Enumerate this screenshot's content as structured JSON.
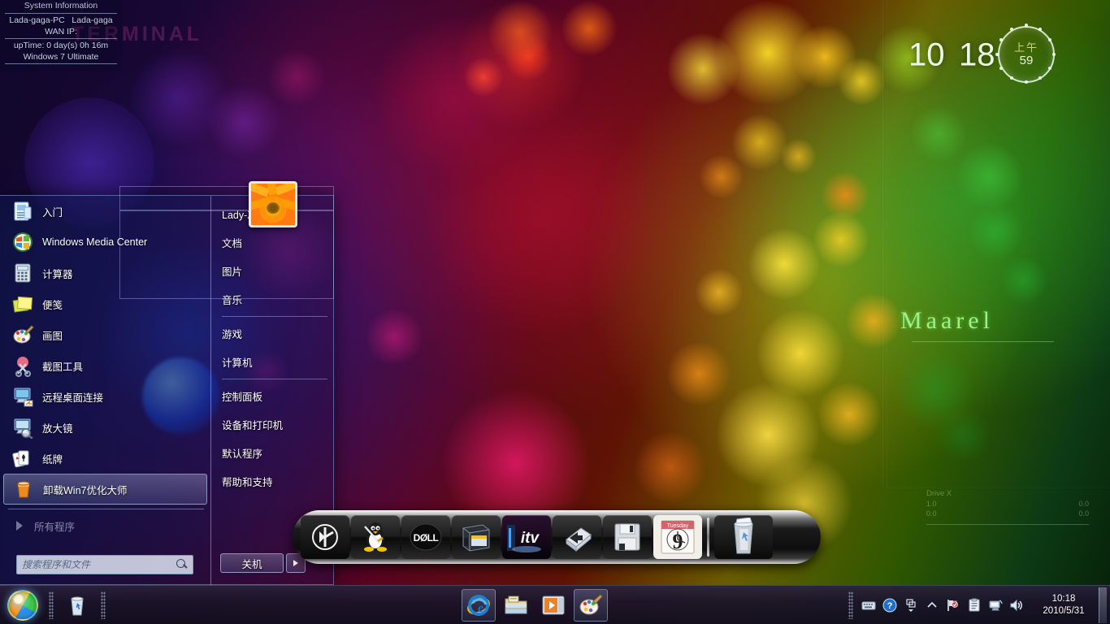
{
  "desktop": {
    "wallpaper_name": "bokeh-lights-wallpaper",
    "watermark_text": "Maarel",
    "faint_text": "TERMINAL",
    "accent_green": "#9ef08c",
    "colors": {
      "purple": "#5a0420",
      "red": "#c81428",
      "yellow": "#e6d21e",
      "green": "#1eb43c",
      "blue": "#2828be"
    }
  },
  "gadgets": {
    "system_info": {
      "title": "System Information",
      "computer_name": "Lada-gaga-PC",
      "user_name": "Lada-gaga",
      "wan_ip_label": "WAN IP:",
      "wan_ip_value": "",
      "uptime": "upTime: 0 day(s) 0h 16m",
      "os": "Windows 7 Ultimate"
    },
    "clock": {
      "hours": "10",
      "minutes": "18",
      "ampm": "上午",
      "seconds": "59"
    },
    "drive": {
      "title": "Drive X",
      "rows": [
        {
          "label": "1.0",
          "value": "0.0"
        },
        {
          "label": "0.0",
          "value": "0.0"
        }
      ]
    }
  },
  "start_menu": {
    "left_items": [
      {
        "label": "入门",
        "icon": "getting-started-icon",
        "selected": false
      },
      {
        "label": "Windows Media Center",
        "icon": "windows-media-center-icon",
        "selected": false
      },
      {
        "label": "计算器",
        "icon": "calculator-icon",
        "selected": false
      },
      {
        "label": "便笺",
        "icon": "sticky-notes-icon",
        "selected": false
      },
      {
        "label": "画图",
        "icon": "paint-icon",
        "selected": false
      },
      {
        "label": "截图工具",
        "icon": "snipping-tool-icon",
        "selected": false
      },
      {
        "label": "远程桌面连接",
        "icon": "remote-desktop-icon",
        "selected": false
      },
      {
        "label": "放大镜",
        "icon": "magnifier-icon",
        "selected": false
      },
      {
        "label": "纸牌",
        "icon": "solitaire-icon",
        "selected": false
      },
      {
        "label": "卸载Win7优化大师",
        "icon": "uninstall-icon",
        "selected": true
      }
    ],
    "all_programs_label": "所有程序",
    "search_placeholder": "搜索程序和文件",
    "search_value": "",
    "user_name": "Lady-Zhuo",
    "avatar_icon": "flower-avatar",
    "right_items": [
      {
        "label": "文档"
      },
      {
        "label": "图片"
      },
      {
        "label": "音乐"
      },
      {
        "label": "游戏"
      },
      {
        "label": "计算机"
      },
      {
        "label": "控制面板"
      },
      {
        "label": "设备和打印机"
      },
      {
        "label": "默认程序"
      },
      {
        "label": "帮助和支持"
      }
    ],
    "shutdown_label": "关机"
  },
  "dock": {
    "items": [
      {
        "name": "apple-finder-icon",
        "glyph": "◐"
      },
      {
        "name": "linux-penguin-icon",
        "glyph": "🐧"
      },
      {
        "name": "dell-logo-icon",
        "glyph": "DÆLL"
      },
      {
        "name": "media-box-icon",
        "glyph": "▤"
      },
      {
        "name": "itv-icon",
        "glyph": "itv"
      },
      {
        "name": "folder-arrow-icon",
        "glyph": "◧"
      },
      {
        "name": "floppy-disk-icon",
        "glyph": "▣"
      },
      {
        "name": "calendar-icon",
        "glyph": "9"
      },
      {
        "name": "recycle-bin-icon",
        "glyph": "♻"
      }
    ],
    "calendar_weekday": "Tuesday",
    "calendar_day": "9"
  },
  "taskbar": {
    "start_button": "start-orb",
    "quick_launch": [
      {
        "name": "recycle-bin-quicklaunch",
        "glyph": "🗑"
      }
    ],
    "task_buttons": [
      {
        "name": "internet-explorer-button",
        "glyph": "e",
        "active": true
      },
      {
        "name": "file-explorer-button",
        "glyph": "🗂",
        "active": false
      },
      {
        "name": "media-player-button",
        "glyph": "▶",
        "active": false
      },
      {
        "name": "paint-button",
        "glyph": "🎨",
        "active": true
      }
    ],
    "tray_icons": [
      {
        "name": "keyboard-language-icon",
        "glyph": "⌨"
      },
      {
        "name": "help-icon",
        "glyph": "?"
      },
      {
        "name": "show-hidden-icons-icon",
        "glyph": "▴"
      },
      {
        "name": "security-flag-icon",
        "glyph": "⚑"
      },
      {
        "name": "clipboard-icon",
        "glyph": "▤"
      },
      {
        "name": "network-icon",
        "glyph": "□"
      },
      {
        "name": "volume-icon",
        "glyph": "🔊"
      }
    ],
    "clock_time": "10:18",
    "clock_date": "2010/5/31"
  }
}
